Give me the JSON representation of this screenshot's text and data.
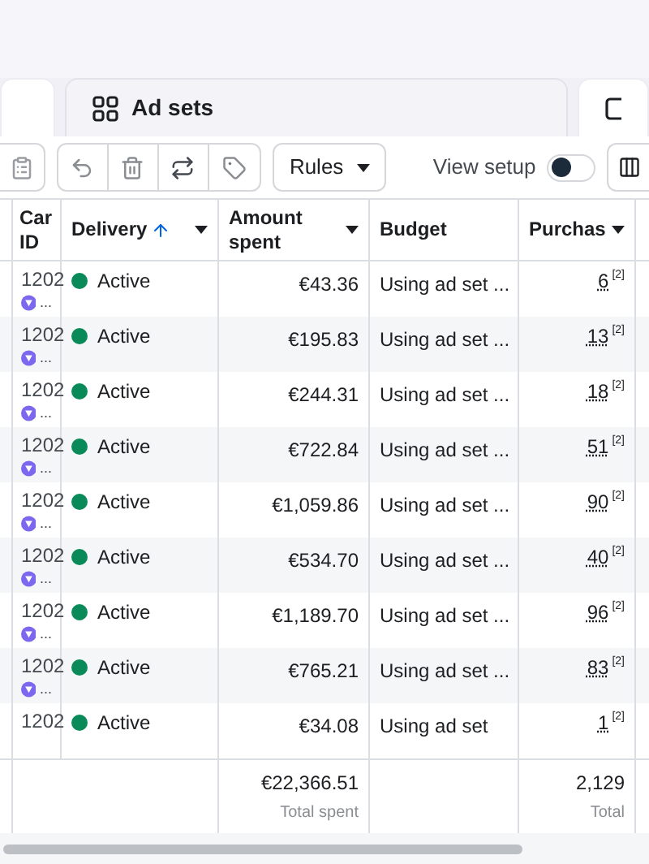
{
  "tabs": [
    {
      "selected": false
    },
    {
      "label": "Ad sets",
      "selected": true
    },
    {
      "selected": false
    }
  ],
  "toolbar": {
    "rules_label": "Rules",
    "view_setup": {
      "label": "View setup",
      "on": false
    }
  },
  "columns": [
    {
      "label": "Car ID",
      "sorted": false,
      "sortable": false
    },
    {
      "label": "Delivery",
      "sorted": true,
      "sortable": true
    },
    {
      "label": "Amount spent",
      "sorted": false,
      "sortable": true
    },
    {
      "label": "Budget",
      "sorted": false,
      "sortable": false
    },
    {
      "label": "Purchas",
      "sorted": false,
      "sortable": true
    }
  ],
  "rows": [
    {
      "id": "1202",
      "id_more": "...",
      "delivery": "Active",
      "spent": "€43.36",
      "budget": "Using ad set ...",
      "purchases": "6",
      "note": "[2]"
    },
    {
      "id": "1202",
      "id_more": "...",
      "delivery": "Active",
      "spent": "€195.83",
      "budget": "Using ad set ...",
      "purchases": "13",
      "note": "[2]"
    },
    {
      "id": "1202",
      "id_more": "...",
      "delivery": "Active",
      "spent": "€244.31",
      "budget": "Using ad set ...",
      "purchases": "18",
      "note": "[2]"
    },
    {
      "id": "1202",
      "id_more": "...",
      "delivery": "Active",
      "spent": "€722.84",
      "budget": "Using ad set ...",
      "purchases": "51",
      "note": "[2]"
    },
    {
      "id": "1202",
      "id_more": "...",
      "delivery": "Active",
      "spent": "€1,059.86",
      "budget": "Using ad set ...",
      "purchases": "90",
      "note": "[2]"
    },
    {
      "id": "1202",
      "id_more": "...",
      "delivery": "Active",
      "spent": "€534.70",
      "budget": "Using ad set ...",
      "purchases": "40",
      "note": "[2]"
    },
    {
      "id": "1202",
      "id_more": "...",
      "delivery": "Active",
      "spent": "€1,189.70",
      "budget": "Using ad set ...",
      "purchases": "96",
      "note": "[2]"
    },
    {
      "id": "1202",
      "id_more": "...",
      "delivery": "Active",
      "spent": "€765.21",
      "budget": "Using ad set ...",
      "purchases": "83",
      "note": "[2]"
    },
    {
      "id": "1202",
      "delivery": "Active",
      "spent": "€34.08",
      "budget": "Using ad set",
      "purchases": "1",
      "note": "[2]"
    }
  ],
  "totals": {
    "spent": "€22,366.51",
    "spent_label": "Total spent",
    "purchases": "2,129",
    "purchases_label": "Total"
  }
}
